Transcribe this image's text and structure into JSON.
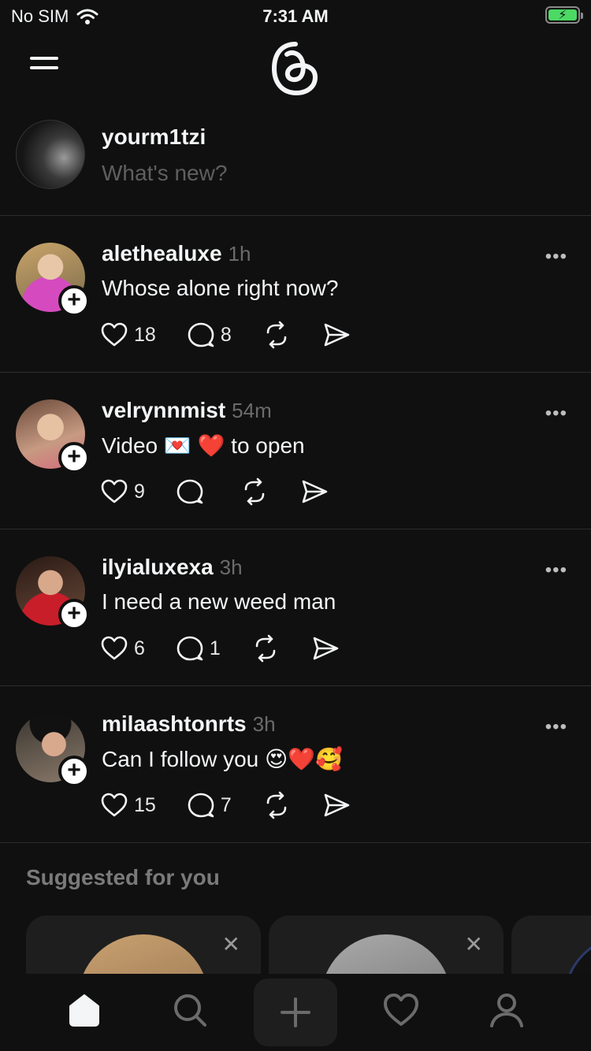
{
  "status_bar": {
    "carrier": "No SIM",
    "time": "7:31 AM"
  },
  "header": {
    "logo": "threads-logo",
    "menu_icon": "menu-icon"
  },
  "composer": {
    "username": "yourm1tzi",
    "placeholder": "What's new?"
  },
  "posts": [
    {
      "username": "alethealuxe",
      "time": "1h",
      "text": "Whose alone right now?",
      "likes": "18",
      "comments": "8"
    },
    {
      "username": "velrynnmist",
      "time": "54m",
      "text": "Video 💌 ❤️ to open",
      "likes": "9",
      "comments": ""
    },
    {
      "username": "ilyialuxexa",
      "time": "3h",
      "text": "I need a new weed man",
      "likes": "6",
      "comments": "1"
    },
    {
      "username": "milaashtonrts",
      "time": "3h",
      "text": "Can I follow you 😍❤️🥰",
      "likes": "15",
      "comments": "7"
    }
  ],
  "suggested": {
    "title": "Suggested for you"
  },
  "colors": {
    "background": "#101010",
    "text": "#f3f5f7",
    "muted": "#6b6b6b",
    "battery": "#4cd964"
  },
  "tabbar": {
    "items": [
      "home-icon",
      "search-icon",
      "create-icon",
      "activity-heart-icon",
      "profile-icon"
    ]
  }
}
